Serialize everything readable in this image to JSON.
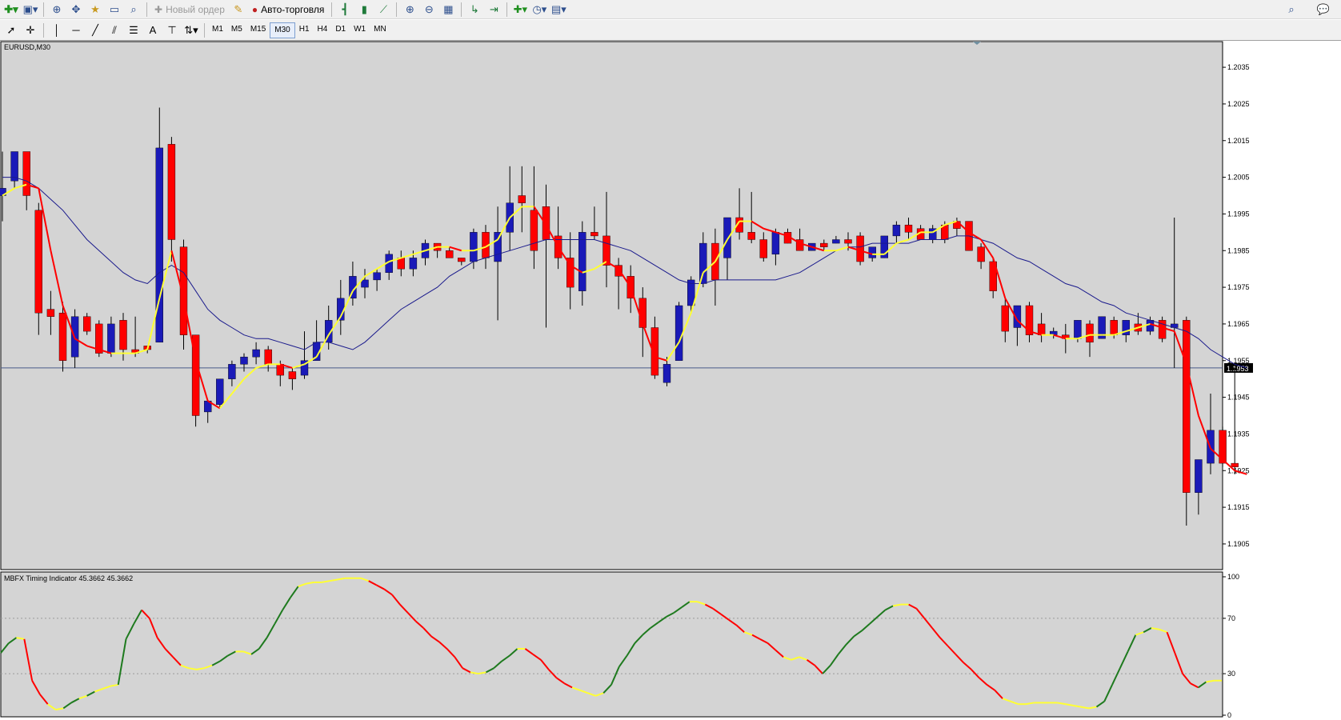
{
  "toolbar": {
    "new_order_label": "Новый ордер",
    "autotrading_label": "Авто-торговля",
    "timeframes": [
      "M1",
      "M5",
      "M15",
      "M30",
      "H1",
      "H4",
      "D1",
      "W1",
      "MN"
    ],
    "active_timeframe": "M30"
  },
  "colors": {
    "bg": "#d4d4d4",
    "bull": "#1a1ab8",
    "bear": "#ff0000",
    "fast_ma": "#ffff33",
    "slow_ma": "#1a1a8c",
    "osc_up": "#1e7a1e",
    "osc_mid": "#ffff33",
    "osc_down": "#ff0000"
  },
  "chart_data": [
    {
      "type": "candlestick",
      "title": "EURUSD,M30",
      "ylim": [
        1.1898,
        1.2042
      ],
      "yticks": [
        "1.2035",
        "1.2025",
        "1.2015",
        "1.2005",
        "1.1995",
        "1.1985",
        "1.1975",
        "1.1965",
        "1.1955",
        "1.1945",
        "1.1935",
        "1.1925",
        "1.1915",
        "1.1905"
      ],
      "current_price": "1.1953",
      "candles": [
        [
          1.2,
          1.2012,
          1.2002,
          1.1993
        ],
        [
          1.2004,
          1.2012,
          1.2012,
          1.2002
        ],
        [
          1.2012,
          1.2012,
          1.2,
          1.1996
        ],
        [
          1.1996,
          1.1998,
          1.1968,
          1.1962
        ],
        [
          1.1969,
          1.1974,
          1.1967,
          1.1962
        ],
        [
          1.1968,
          1.1971,
          1.1955,
          1.1952
        ],
        [
          1.1956,
          1.1969,
          1.1967,
          1.1953
        ],
        [
          1.1967,
          1.1968,
          1.1963,
          1.1962
        ],
        [
          1.1965,
          1.1966,
          1.1957,
          1.1956
        ],
        [
          1.1957,
          1.1967,
          1.1965,
          1.1956
        ],
        [
          1.1966,
          1.1968,
          1.1958,
          1.1955
        ],
        [
          1.1958,
          1.1967,
          1.1957,
          1.1956
        ],
        [
          1.1959,
          1.1959,
          1.1958,
          1.1957
        ],
        [
          1.196,
          1.2024,
          1.2013,
          1.196
        ],
        [
          1.2014,
          1.2016,
          1.1988,
          1.1982
        ],
        [
          1.1986,
          1.1988,
          1.1962,
          1.1958
        ],
        [
          1.1962,
          1.1962,
          1.194,
          1.1937
        ],
        [
          1.1941,
          1.1944,
          1.1944,
          1.1938
        ],
        [
          1.1943,
          1.195,
          1.195,
          1.1942
        ],
        [
          1.195,
          1.1955,
          1.1954,
          1.1948
        ],
        [
          1.1954,
          1.1957,
          1.1956,
          1.1952
        ],
        [
          1.1956,
          1.196,
          1.1958,
          1.1954
        ],
        [
          1.1958,
          1.1959,
          1.1954,
          1.1952
        ],
        [
          1.1954,
          1.1955,
          1.1951,
          1.1948
        ],
        [
          1.1952,
          1.1953,
          1.195,
          1.1947
        ],
        [
          1.1951,
          1.1963,
          1.1955,
          1.195
        ],
        [
          1.1955,
          1.1966,
          1.196,
          1.1956
        ],
        [
          1.196,
          1.197,
          1.1966,
          1.1958
        ],
        [
          1.1966,
          1.1977,
          1.1972,
          1.1962
        ],
        [
          1.1972,
          1.1982,
          1.1978,
          1.197
        ],
        [
          1.1975,
          1.198,
          1.1977,
          1.1972
        ],
        [
          1.1977,
          1.198,
          1.1979,
          1.1974
        ],
        [
          1.1979,
          1.1985,
          1.1984,
          1.1977
        ],
        [
          1.1983,
          1.1985,
          1.198,
          1.1978
        ],
        [
          1.198,
          1.1985,
          1.1983,
          1.1978
        ],
        [
          1.1983,
          1.1988,
          1.1987,
          1.1981
        ],
        [
          1.1987,
          1.1987,
          1.1985,
          1.1983
        ],
        [
          1.1985,
          1.1986,
          1.1983,
          1.1983
        ],
        [
          1.1983,
          1.1983,
          1.1982,
          1.1981
        ],
        [
          1.1982,
          1.1991,
          1.199,
          1.198
        ],
        [
          1.199,
          1.1992,
          1.1983,
          1.198
        ],
        [
          1.1982,
          1.1997,
          1.199,
          1.1966
        ],
        [
          1.199,
          1.2008,
          1.1998,
          1.1985
        ],
        [
          1.2,
          1.2008,
          1.1998,
          1.199
        ],
        [
          1.1996,
          1.2008,
          1.1985,
          1.198
        ],
        [
          1.1997,
          1.2003,
          1.1988,
          1.1964
        ],
        [
          1.1989,
          1.1997,
          1.1983,
          1.198
        ],
        [
          1.1983,
          1.199,
          1.1975,
          1.1969
        ],
        [
          1.1974,
          1.1993,
          1.199,
          1.197
        ],
        [
          1.199,
          1.1997,
          1.1989,
          1.1988
        ],
        [
          1.1989,
          1.2001,
          1.1981,
          1.1975
        ],
        [
          1.1981,
          1.1983,
          1.1978,
          1.1969
        ],
        [
          1.1978,
          1.1981,
          1.1972,
          1.1968
        ],
        [
          1.1972,
          1.1975,
          1.1964,
          1.1956
        ],
        [
          1.1964,
          1.1967,
          1.1951,
          1.195
        ],
        [
          1.1949,
          1.1956,
          1.1954,
          1.1948
        ],
        [
          1.1955,
          1.1971,
          1.197,
          1.1955
        ],
        [
          1.197,
          1.1978,
          1.1977,
          1.1968
        ],
        [
          1.1976,
          1.199,
          1.1987,
          1.1975
        ],
        [
          1.1987,
          1.1991,
          1.1977,
          1.197
        ],
        [
          1.1983,
          1.1992,
          1.1994,
          1.1977
        ],
        [
          1.1994,
          1.2002,
          1.199,
          1.1988
        ],
        [
          1.199,
          1.2001,
          1.1988,
          1.1987
        ],
        [
          1.1988,
          1.199,
          1.1983,
          1.1982
        ],
        [
          1.1984,
          1.1991,
          1.199,
          1.1981
        ],
        [
          1.199,
          1.1991,
          1.1987,
          1.1987
        ],
        [
          1.1988,
          1.1991,
          1.1985,
          1.1985
        ],
        [
          1.1985,
          1.1986,
          1.1987,
          1.1985
        ],
        [
          1.1987,
          1.1988,
          1.1986,
          1.1985
        ],
        [
          1.1987,
          1.1989,
          1.1988,
          1.1987
        ],
        [
          1.1988,
          1.199,
          1.1987,
          1.1985
        ],
        [
          1.1989,
          1.199,
          1.1982,
          1.1981
        ],
        [
          1.1983,
          1.1984,
          1.1986,
          1.1982
        ],
        [
          1.1983,
          1.1989,
          1.1989,
          1.1983
        ],
        [
          1.1989,
          1.1993,
          1.1992,
          1.1987
        ],
        [
          1.1992,
          1.1994,
          1.199,
          1.1988
        ],
        [
          1.1991,
          1.1992,
          1.1988,
          1.1988
        ],
        [
          1.1988,
          1.1992,
          1.1991,
          1.1987
        ],
        [
          1.1992,
          1.1993,
          1.1988,
          1.1987
        ],
        [
          1.1993,
          1.1994,
          1.1991,
          1.1989
        ],
        [
          1.1993,
          1.1993,
          1.1985,
          1.1985
        ],
        [
          1.1986,
          1.1987,
          1.1982,
          1.198
        ],
        [
          1.1982,
          1.1983,
          1.1974,
          1.1972
        ],
        [
          1.197,
          1.1972,
          1.1963,
          1.196
        ],
        [
          1.1964,
          1.1968,
          1.197,
          1.1959
        ],
        [
          1.197,
          1.1971,
          1.1962,
          1.196
        ],
        [
          1.1965,
          1.1968,
          1.1962,
          1.196
        ],
        [
          1.1962,
          1.1964,
          1.1963,
          1.1961
        ],
        [
          1.1962,
          1.1965,
          1.1961,
          1.1957
        ],
        [
          1.1961,
          1.1966,
          1.1966,
          1.196
        ],
        [
          1.1965,
          1.1966,
          1.196,
          1.1956
        ],
        [
          1.1961,
          1.1967,
          1.1967,
          1.1961
        ],
        [
          1.1966,
          1.1967,
          1.1962,
          1.1961
        ],
        [
          1.1962,
          1.1966,
          1.1966,
          1.196
        ],
        [
          1.1965,
          1.1968,
          1.1963,
          1.1962
        ],
        [
          1.1963,
          1.1967,
          1.1966,
          1.1962
        ],
        [
          1.1966,
          1.1967,
          1.1961,
          1.196
        ],
        [
          1.1964,
          1.1994,
          1.1965,
          1.1953
        ],
        [
          1.1966,
          1.1967,
          1.1919,
          1.191
        ],
        [
          1.1919,
          1.1928,
          1.1928,
          1.1913
        ],
        [
          1.1927,
          1.1946,
          1.1936,
          1.1924
        ],
        [
          1.1936,
          1.1937,
          1.1927,
          1.1926
        ],
        [
          1.1927,
          1.1953,
          1.1926,
          1.1924
        ]
      ],
      "fast_ma": [
        1.2,
        1.2002,
        1.2003,
        1.2002,
        1.1985,
        1.197,
        1.1961,
        1.1959,
        1.1958,
        1.1957,
        1.1957,
        1.1957,
        1.1958,
        1.1972,
        1.1985,
        1.1972,
        1.1955,
        1.1944,
        1.1942,
        1.1946,
        1.195,
        1.1953,
        1.1954,
        1.1954,
        1.1953,
        1.1954,
        1.1956,
        1.1962,
        1.1967,
        1.1974,
        1.1978,
        1.198,
        1.1982,
        1.1983,
        1.1984,
        1.1985,
        1.1986,
        1.1986,
        1.1985,
        1.1985,
        1.1986,
        1.1988,
        1.1994,
        1.1997,
        1.1997,
        1.1992,
        1.1986,
        1.1981,
        1.1979,
        1.198,
        1.1982,
        1.198,
        1.1975,
        1.1965,
        1.1956,
        1.1955,
        1.196,
        1.1968,
        1.1979,
        1.1982,
        1.1988,
        1.1993,
        1.1993,
        1.1991,
        1.199,
        1.1989,
        1.1987,
        1.1986,
        1.1985,
        1.1985,
        1.1986,
        1.1985,
        1.1984,
        1.1984,
        1.1987,
        1.1988,
        1.199,
        1.199,
        1.1992,
        1.1993,
        1.199,
        1.1988,
        1.1983,
        1.1972,
        1.1966,
        1.1963,
        1.1962,
        1.1962,
        1.1961,
        1.1961,
        1.1962,
        1.1962,
        1.1962,
        1.1963,
        1.1964,
        1.1965,
        1.1964,
        1.1963,
        1.1954,
        1.194,
        1.1931,
        1.1928,
        1.1925,
        1.1924
      ],
      "slow_ma": [
        1.2005,
        1.2005,
        1.2004,
        1.2002,
        1.1999,
        1.1996,
        1.1992,
        1.1988,
        1.1985,
        1.1982,
        1.1979,
        1.1977,
        1.1976,
        1.1979,
        1.1981,
        1.1979,
        1.1974,
        1.1969,
        1.1966,
        1.1964,
        1.1962,
        1.1961,
        1.1961,
        1.196,
        1.1959,
        1.1958,
        1.196,
        1.196,
        1.1959,
        1.1958,
        1.196,
        1.1963,
        1.1966,
        1.1969,
        1.1971,
        1.1973,
        1.1975,
        1.1978,
        1.198,
        1.1982,
        1.1983,
        1.1984,
        1.1985,
        1.1986,
        1.1987,
        1.1988,
        1.1988,
        1.1988,
        1.1988,
        1.1988,
        1.1987,
        1.1986,
        1.1985,
        1.1983,
        1.1981,
        1.1979,
        1.1977,
        1.1976,
        1.1976,
        1.1977,
        1.1977,
        1.1977,
        1.1977,
        1.1977,
        1.1977,
        1.1978,
        1.1979,
        1.1981,
        1.1983,
        1.1985,
        1.1986,
        1.1986,
        1.1987,
        1.1987,
        1.1987,
        1.1987,
        1.1988,
        1.1988,
        1.1988,
        1.1989,
        1.1989,
        1.1988,
        1.1987,
        1.1985,
        1.1983,
        1.1982,
        1.198,
        1.1978,
        1.1976,
        1.1975,
        1.1973,
        1.1971,
        1.197,
        1.1968,
        1.1967,
        1.1966,
        1.1965,
        1.1964,
        1.1963,
        1.1961,
        1.1958,
        1.1956,
        1.1954,
        1.1953
      ]
    },
    {
      "type": "line",
      "title": "MBFX Timing Indicator 45.3662 45.3662",
      "ylim": [
        0,
        100
      ],
      "yticks": [
        "100",
        "70",
        "30",
        "0"
      ],
      "levels": [
        70,
        30
      ],
      "values": [
        45,
        52,
        56,
        55,
        25,
        15,
        8,
        4,
        5,
        9,
        12,
        14,
        17,
        19,
        21,
        22,
        55,
        66,
        76,
        70,
        56,
        48,
        42,
        36,
        34,
        33,
        34,
        36,
        39,
        43,
        46,
        46,
        44,
        48,
        56,
        66,
        76,
        85,
        93,
        95,
        96,
        96,
        97,
        98,
        99,
        99,
        99,
        97,
        94,
        91,
        87,
        80,
        74,
        68,
        63,
        57,
        53,
        48,
        42,
        34,
        31,
        30,
        31,
        34,
        39,
        43,
        48,
        48,
        44,
        40,
        33,
        27,
        23,
        20,
        18,
        16,
        14,
        16,
        22,
        35,
        43,
        52,
        58,
        63,
        67,
        71,
        74,
        78,
        82,
        82,
        80,
        77,
        73,
        69,
        65,
        60,
        58,
        55,
        52,
        47,
        42,
        40,
        42,
        40,
        36,
        30,
        36,
        44,
        51,
        57,
        61,
        66,
        71,
        76,
        79,
        80,
        80,
        77,
        70,
        63,
        56,
        50,
        44,
        38,
        33,
        27,
        22,
        18,
        12,
        10,
        8,
        8,
        9,
        9,
        9,
        9,
        8,
        7,
        6,
        5,
        6,
        10,
        22,
        34,
        46,
        58,
        60,
        63,
        62,
        60,
        45,
        30,
        23,
        20,
        24,
        25,
        25
      ]
    }
  ]
}
